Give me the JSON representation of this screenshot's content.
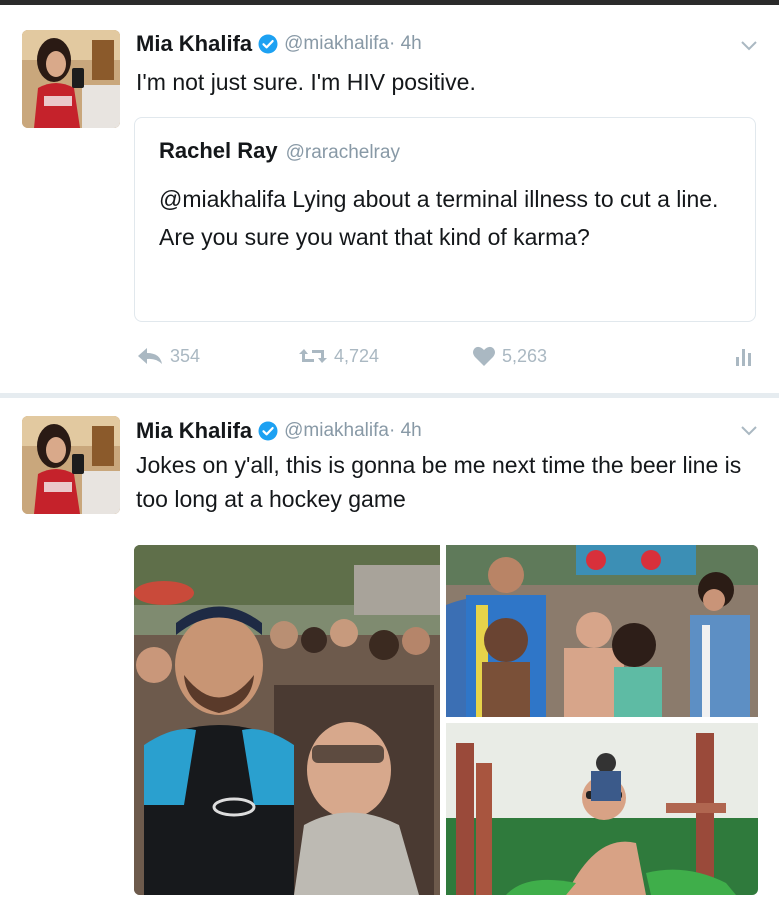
{
  "tweets": [
    {
      "author": {
        "name": "Mia Khalifa",
        "handle": "@miakhalifa",
        "time": "· 4h",
        "verified": true
      },
      "text": "I'm not just sure. I'm HIV positive.",
      "quoted": {
        "name": "Rachel Ray",
        "handle": "@rarachelray",
        "text": "@miakhalifa Lying about a terminal illness to cut a line. Are you sure you want that kind of karma?"
      },
      "actions": {
        "replies": "354",
        "retweets": "4,724",
        "likes": "5,263"
      }
    },
    {
      "author": {
        "name": "Mia Khalifa",
        "handle": "@miakhalifa",
        "time": "· 4h",
        "verified": true
      },
      "text": "Jokes on y'all, this is gonna be me next time the beer line is too long at a hockey game"
    }
  ],
  "icons": {
    "verified": "verified-badge-icon",
    "caret": "chevron-down-icon",
    "reply": "reply-icon",
    "retweet": "retweet-icon",
    "like": "heart-icon",
    "analytics": "analytics-icon"
  },
  "colors": {
    "verified": "#1da1f2",
    "muted": "#8899a6",
    "action": "#aab8c2",
    "border": "#e1e8ed"
  }
}
